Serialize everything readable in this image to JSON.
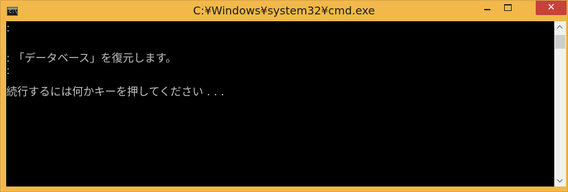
{
  "window": {
    "title": "C:¥Windows¥system32¥cmd.exe",
    "icon": "cmd-console-icon",
    "icon_text": "C:\\",
    "close_glyph": "✕",
    "frame_color": "#f2b84a",
    "close_color": "#c7423a"
  },
  "console": {
    "lines": [
      ":",
      ": 「データベース」を復元します。",
      ":",
      "続行するには何かキーを押してください . . ."
    ],
    "background": "#000000",
    "text_color": "#c0c0c0"
  },
  "scrollbar": {
    "up_icon": "chevron-up-icon",
    "down_icon": "chevron-down-icon"
  }
}
